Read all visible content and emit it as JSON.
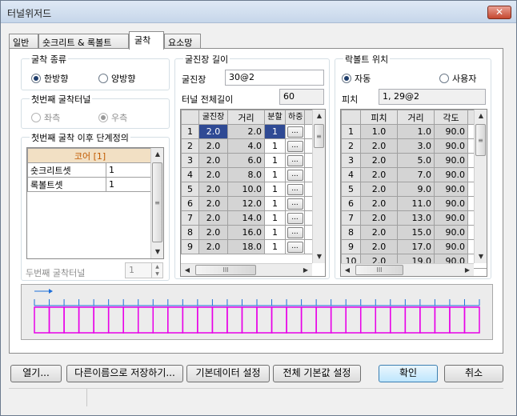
{
  "window": {
    "title": "터널위저드",
    "close_glyph": "✕"
  },
  "tabs": [
    {
      "label": "일반"
    },
    {
      "label": "숏크리트 & 록볼트"
    },
    {
      "label": "굴착"
    },
    {
      "label": "요소망"
    }
  ],
  "excavation_type": {
    "title": "굴착 종류",
    "one_way": "한방향",
    "two_way": "양방향",
    "selected": "one_way"
  },
  "first_tunnel": {
    "title": "첫번째 굴착터널",
    "left": "좌측",
    "right": "우측",
    "selected": "right"
  },
  "stage_def": {
    "title": "첫번째 굴착 이후 단계정의",
    "header": "코어 [1]",
    "rows": [
      {
        "name": "숏크리트셋",
        "value": "1"
      },
      {
        "name": "록볼트셋",
        "value": "1"
      }
    ]
  },
  "second_tunnel": {
    "label": "두번째 굴착터널",
    "value": "1"
  },
  "advance": {
    "title": "굴진장 길이",
    "length_label": "굴진장",
    "length_value": "30@2",
    "total_label": "터널 전체길이",
    "total_value": "60",
    "headers": [
      "굴진장",
      "거리",
      "분할",
      "하중"
    ],
    "ellipsis": "...",
    "rows": [
      {
        "row": "1",
        "len": "2.0",
        "dist": "2.0",
        "div": "1"
      },
      {
        "row": "2",
        "len": "2.0",
        "dist": "4.0",
        "div": "1"
      },
      {
        "row": "3",
        "len": "2.0",
        "dist": "6.0",
        "div": "1"
      },
      {
        "row": "4",
        "len": "2.0",
        "dist": "8.0",
        "div": "1"
      },
      {
        "row": "5",
        "len": "2.0",
        "dist": "10.0",
        "div": "1"
      },
      {
        "row": "6",
        "len": "2.0",
        "dist": "12.0",
        "div": "1"
      },
      {
        "row": "7",
        "len": "2.0",
        "dist": "14.0",
        "div": "1"
      },
      {
        "row": "8",
        "len": "2.0",
        "dist": "16.0",
        "div": "1"
      },
      {
        "row": "9",
        "len": "2.0",
        "dist": "18.0",
        "div": "1"
      }
    ]
  },
  "rockbolt": {
    "title": "락볼트 위치",
    "auto": "자동",
    "user": "사용자",
    "selected": "auto",
    "pitch_label": "피치",
    "pitch_value": "1, 29@2",
    "headers": [
      "피치",
      "거리",
      "각도"
    ],
    "rows": [
      {
        "row": "1",
        "pitch": "1.0",
        "dist": "1.0",
        "angle": "90.0"
      },
      {
        "row": "2",
        "pitch": "2.0",
        "dist": "3.0",
        "angle": "90.0"
      },
      {
        "row": "3",
        "pitch": "2.0",
        "dist": "5.0",
        "angle": "90.0"
      },
      {
        "row": "4",
        "pitch": "2.0",
        "dist": "7.0",
        "angle": "90.0"
      },
      {
        "row": "5",
        "pitch": "2.0",
        "dist": "9.0",
        "angle": "90.0"
      },
      {
        "row": "6",
        "pitch": "2.0",
        "dist": "11.0",
        "angle": "90.0"
      },
      {
        "row": "7",
        "pitch": "2.0",
        "dist": "13.0",
        "angle": "90.0"
      },
      {
        "row": "8",
        "pitch": "2.0",
        "dist": "15.0",
        "angle": "90.0"
      },
      {
        "row": "9",
        "pitch": "2.0",
        "dist": "17.0",
        "angle": "90.0"
      },
      {
        "row": "10",
        "pitch": "2.0",
        "dist": "19.0",
        "angle": "90.0"
      }
    ]
  },
  "preview": {
    "segments": 30,
    "box_color": "#e800e8",
    "tick_color": "#1e6fd9"
  },
  "buttons": {
    "open": "열기...",
    "save_as": "다른이름으로 저장하기...",
    "default_data": "기본데이터 설정",
    "all_defaults": "전체 기본값 설정",
    "ok": "확인",
    "cancel": "취소"
  }
}
